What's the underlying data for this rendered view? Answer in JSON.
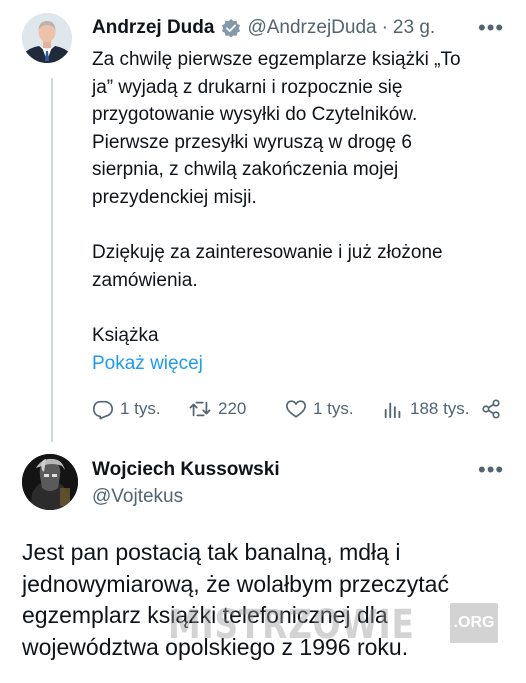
{
  "tweet": {
    "author": {
      "name": "Andrzej Duda",
      "handle": "@AndrzejDuda",
      "separator": "·",
      "time": "23 g."
    },
    "paragraphs": [
      "Za chwilę pierwsze egzemplarze książki „To\nja” wyjadą z drukarni i rozpocznie się\nprzygotowanie wysyłki do Czytelników.\nPierwsze przesyłki wyruszą w drogę 6\nsierpnia, z chwilą zakończenia mojej\nprezydenckiej misji.",
      "Dziękuję za zainteresowanie i już złożone\nzamówienia.",
      "Książka"
    ],
    "show_more": "Pokaż więcej",
    "actions": {
      "replies": "1 tys.",
      "reposts": "220",
      "likes": "1 tys.",
      "views": "188 tys."
    },
    "icons": [
      "verified-badge-icon",
      "more-icon",
      "reply-icon",
      "repost-icon",
      "like-icon",
      "views-icon",
      "share-icon"
    ]
  },
  "reply": {
    "author": {
      "name": "Wojciech Kussowski",
      "handle": "@Vojtekus"
    },
    "text": "Jest pan postacią tak banalną, mdłą i\njednowymiarową, że wolałbym przeczytać\negzemplarz książki telefonicznej dla\nwojewództwa opolskiego z  1996 roku."
  },
  "watermark": {
    "text": "MISTRZOWIE",
    "suffix": ".ORG"
  },
  "colors": {
    "text": "#0f1419",
    "secondary": "#536471",
    "link": "#1d9bf0",
    "thread_line": "#cfd9de"
  }
}
